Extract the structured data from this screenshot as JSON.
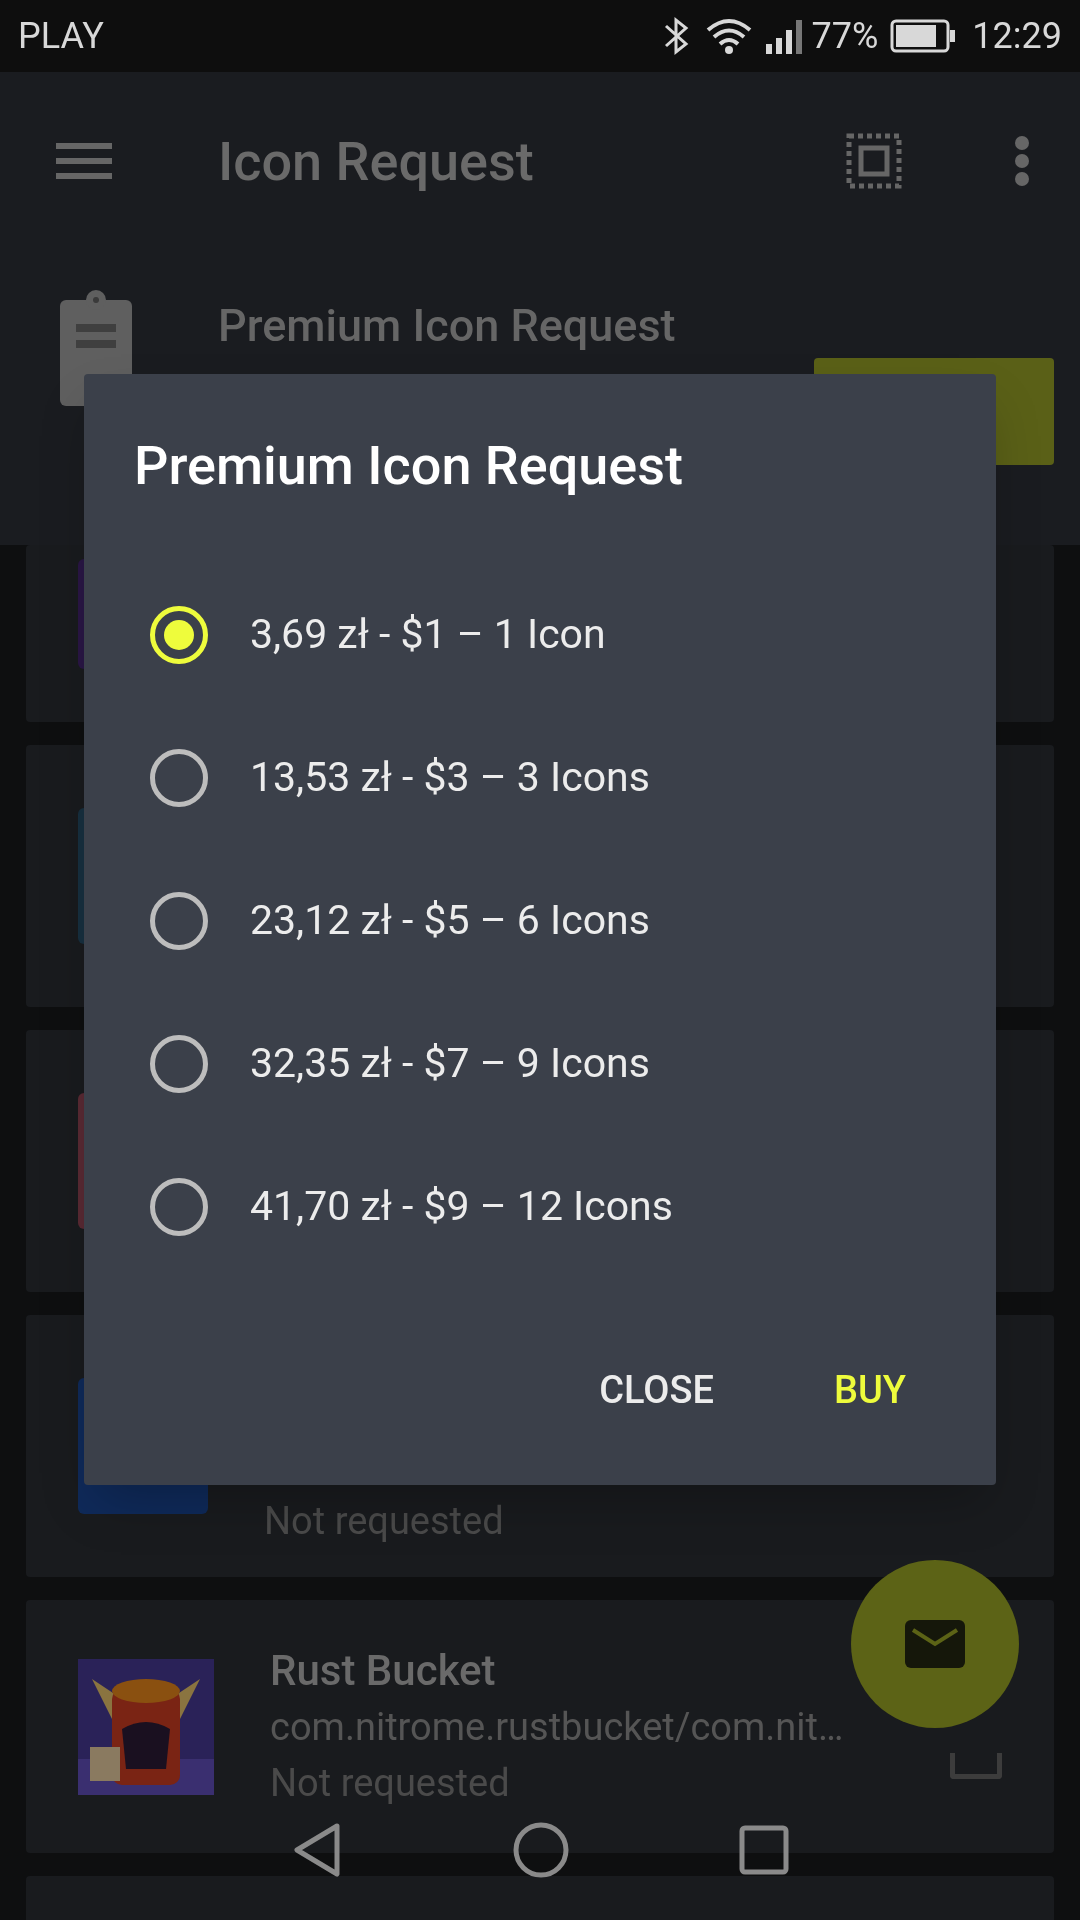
{
  "status_bar": {
    "carrier": "PLAY",
    "battery": "77%",
    "time": "12:29"
  },
  "app_bar": {
    "title": "Icon Request"
  },
  "header": {
    "title": "Premium Icon Request"
  },
  "apps": [
    {
      "kind": "partial",
      "status": "Not requested"
    },
    {
      "kind": "full",
      "name": "Rust Bucket",
      "package": "com.nitrome.rustbucket/com.nit…",
      "status": "Not requested",
      "checked": false
    }
  ],
  "dialog": {
    "title": "Premium Icon Request",
    "options": [
      {
        "label": "3,69 zł - $1 – 1 Icon",
        "selected": true
      },
      {
        "label": "13,53 zł - $3 – 3 Icons",
        "selected": false
      },
      {
        "label": "23,12 zł - $5 – 6 Icons",
        "selected": false
      },
      {
        "label": "32,35 zł - $7 – 9 Icons",
        "selected": false
      },
      {
        "label": "41,70 zł - $9 – 12 Icons",
        "selected": false
      }
    ],
    "buttons": [
      {
        "label": "CLOSE",
        "kind": "neutral"
      },
      {
        "label": "BUY",
        "kind": "accent"
      }
    ]
  }
}
